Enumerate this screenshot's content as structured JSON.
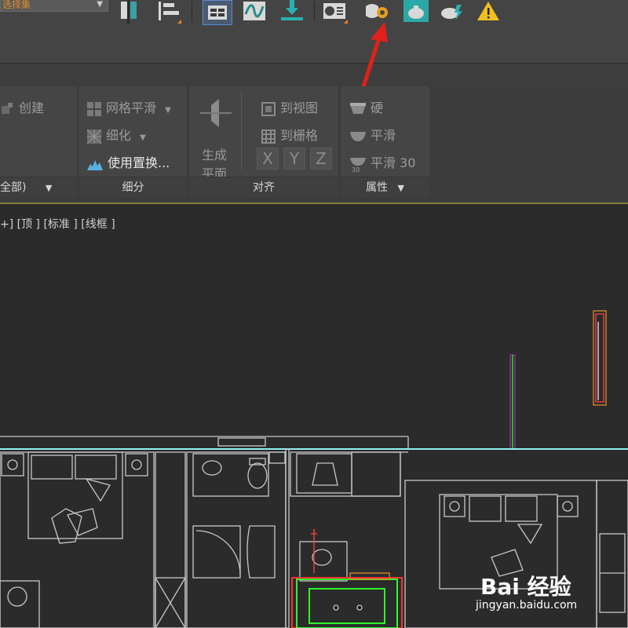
{
  "toolbar": {
    "selection_set": "选择集",
    "icons": [
      "render-frame-icon",
      "align-icon",
      "schematic-icon",
      "curve-editor-icon",
      "save-icon",
      "material-editor-icon",
      "render-setup-icon",
      "render-teapot-icon",
      "render-iterative-icon",
      "warning-icon"
    ]
  },
  "ribbon": {
    "panel1": {
      "create": "创建",
      "footer": "全部)"
    },
    "subdivision": {
      "mesh_smooth": "网格平滑",
      "tessellate": "细化",
      "use_displacement": "使用置换...",
      "footer": "细分"
    },
    "align": {
      "generate_plane_line1": "生成",
      "generate_plane_line2": "平面",
      "to_view": "到视图",
      "to_grid": "到栅格",
      "x": "X",
      "y": "Y",
      "z": "Z",
      "footer": "对齐"
    },
    "properties": {
      "hard": "硬",
      "smooth": "平滑",
      "smooth30": "平滑 30",
      "footer": "属性"
    }
  },
  "viewport": {
    "label": "+] [顶 ] [标准 ] [线框 ]"
  },
  "watermark": {
    "brand": "Bai 经验",
    "url": "jingyan.baidu.com"
  },
  "colors": {
    "arrow": "#e0201a",
    "accent_orange": "#e08a2e",
    "wireframe_gray": "#c8c8c8",
    "wireframe_green": "#2aff2a",
    "wireframe_red": "#ff3030",
    "cyan_line": "#8ff0f0"
  }
}
